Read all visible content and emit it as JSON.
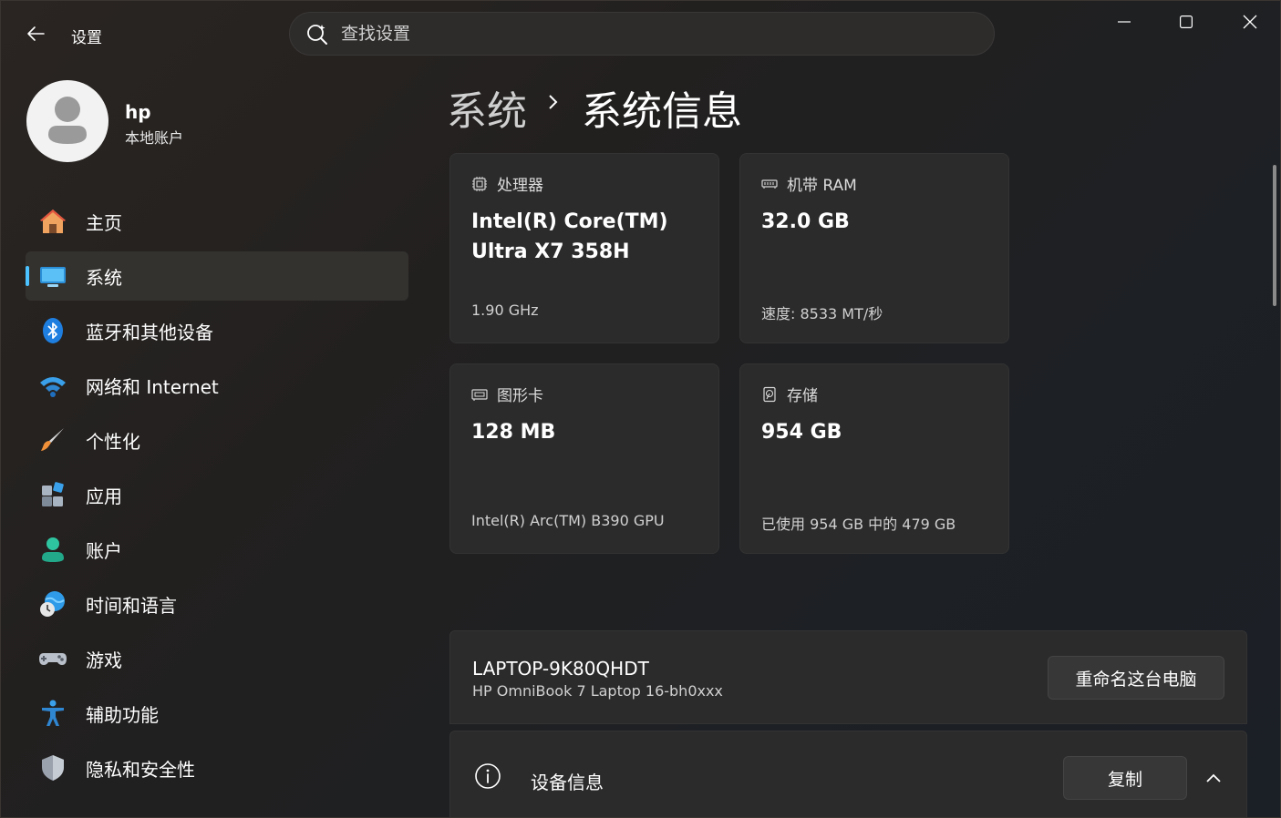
{
  "titlebar": {
    "app_title": "设置",
    "search_placeholder": "查找设置"
  },
  "profile": {
    "name": "hp",
    "account_type": "本地账户"
  },
  "sidebar": {
    "items": [
      {
        "label": "主页",
        "icon": "home-icon"
      },
      {
        "label": "系统",
        "icon": "system-icon",
        "selected": true
      },
      {
        "label": "蓝牙和其他设备",
        "icon": "bluetooth-icon"
      },
      {
        "label": "网络和 Internet",
        "icon": "wifi-icon"
      },
      {
        "label": "个性化",
        "icon": "brush-icon"
      },
      {
        "label": "应用",
        "icon": "apps-icon"
      },
      {
        "label": "账户",
        "icon": "account-icon"
      },
      {
        "label": "时间和语言",
        "icon": "globe-clock-icon"
      },
      {
        "label": "游戏",
        "icon": "gamepad-icon"
      },
      {
        "label": "辅助功能",
        "icon": "accessibility-icon"
      },
      {
        "label": "隐私和安全性",
        "icon": "shield-icon"
      }
    ]
  },
  "breadcrumb": {
    "parent": "系统",
    "current": "系统信息"
  },
  "cards": {
    "processor": {
      "label": "处理器",
      "value": "Intel(R) Core(TM) Ultra X7 358H",
      "sub": "1.90 GHz"
    },
    "ram": {
      "label": "机带 RAM",
      "value": "32.0 GB",
      "sub": "速度: 8533 MT/秒"
    },
    "gpu": {
      "label": "图形卡",
      "value": "128 MB",
      "sub": "Intel(R) Arc(TM) B390 GPU"
    },
    "storage": {
      "label": "存储",
      "value": "954 GB",
      "sub": "已使用 954 GB 中的 479 GB"
    }
  },
  "device": {
    "name": "LAPTOP-9K80QHDT",
    "model": "HP OmniBook 7 Laptop 16-bh0xxx",
    "rename_label": "重命名这台电脑"
  },
  "device_info": {
    "label": "设备信息",
    "copy_label": "复制"
  },
  "colors": {
    "accent": "#4cc2ff",
    "card_bg": "#2b2b2b",
    "selected_bg": "#34322f"
  }
}
